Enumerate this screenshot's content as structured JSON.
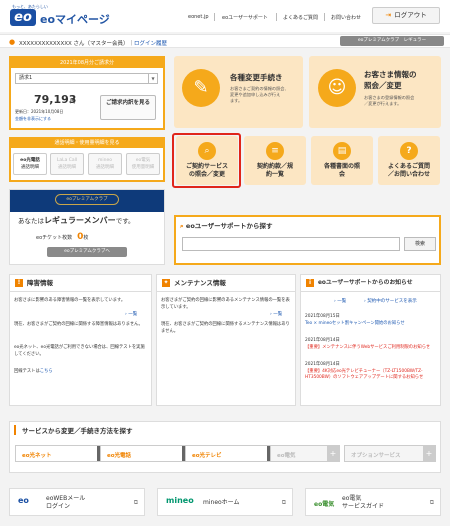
{
  "header": {
    "tagline": "もっと、あたらしい",
    "logo": "eo",
    "title": "eoマイページ",
    "nav": [
      "eonet.jp",
      "eoユーザーサポート",
      "よくあるご質問",
      "お問い合わせ"
    ],
    "logout": "ログアウト"
  },
  "user": {
    "name": "XXXXXXXXXXXXXX さん（マスター会員）",
    "login_history": "ログイン履歴",
    "premium_badge": "eoプレミアムクラブ　レギュラー"
  },
  "bill": {
    "title": "2021年08月分ご請求分",
    "select": "請求1",
    "amount": "79,193",
    "unit": "円",
    "updated": "更新日：2021年10月08日",
    "link": "金額を非表示にする",
    "detail_button": "ご請求内訳を見る"
  },
  "calls": {
    "title": "通話明細・使用量明細を見る",
    "items": [
      {
        "line1": "eo光電話",
        "line2": "通話明細"
      },
      {
        "line1": "LaLa Call",
        "line2": "通話明細"
      },
      {
        "line1": "mineo",
        "line2": "通話明細"
      },
      {
        "line1": "eo電気",
        "line2": "使用量明細"
      }
    ]
  },
  "premium": {
    "logo": "eoプレミアムクラブ",
    "member_prefix": "あなたは",
    "member_rank": "レギュラーメンバー",
    "member_suffix": "です。",
    "ticket_label": "eoチケット枚数",
    "ticket_count": "0",
    "ticket_unit": "枚",
    "button": "eoプレミアムクラブへ"
  },
  "tiles": {
    "procedures": {
      "title": "各種変更手続き",
      "desc": [
        "お客さまご契約の情報の照会、",
        "変更や追加申し込みが行え",
        "ます。"
      ]
    },
    "customer": {
      "title1": "お客さま情報の",
      "title2": "照会／変更",
      "desc": [
        "お客さまの登録情報の照会",
        "／変更が行えます。"
      ]
    },
    "small": [
      {
        "line1": "ご契約サービス",
        "line2": "の照会／変更"
      },
      {
        "line1": "契約約款／規",
        "line2": "約一覧"
      },
      {
        "line1": "各種書面の照",
        "line2": "会"
      },
      {
        "line1": "よくあるご質問",
        "line2": "／お問い合わせ"
      }
    ]
  },
  "search": {
    "title": "eoユーザーサポートから探す",
    "button": "検索",
    "placeholder": ""
  },
  "trouble": {
    "title": "障害情報",
    "p1": [
      "お客さまに影響のある障害情報の一覧を表示しています。"
    ],
    "list_link": "一覧",
    "p2": [
      "現在、お客さまがご契約の回線に関係する障害情報はありません。"
    ],
    "p3": [
      "eo光ネット、eo光電話がご利用できない場合は、回線テストを実施してください。"
    ],
    "test_label": "回線テストは",
    "test_link": "こちら"
  },
  "maintenance": {
    "title": "メンテナンス情報",
    "p1": [
      "お客さまがご契約の回線に影響のあるメンテナンス情報の一覧を表示しています。"
    ],
    "list_link": "一覧",
    "p2": [
      "現在、お客さまがご契約の回線に関係するメンテナンス情報はありません。"
    ]
  },
  "news": {
    "title": "eoユーザーサポートからのお知らせ",
    "list_link": "一覧",
    "svc_link": "契約中のサービスを表示",
    "items": [
      {
        "date": "2021年08月15日",
        "text": "Teo × mineoセット割キャンペーン開始のお知らせ",
        "type": "normal"
      },
      {
        "date": "2021年08月14日",
        "text": "【重要】メンテナンスに伴うWebサービスご利用制限のお知らせ",
        "type": "important"
      },
      {
        "date": "2021年08月14日",
        "text": "【重要】4K対応eo光テレビチューナー（TZ-LT1500BW/TZ-HT3500BW）のソフトウェアアップデートに関するお知らせ",
        "type": "important"
      }
    ]
  },
  "service_change": {
    "title": "サービスから変更／手続き方法を探す",
    "items": [
      {
        "name": "eo光ネット",
        "disabled": false
      },
      {
        "name": "eo光電話",
        "disabled": false
      },
      {
        "name": "eo光テレビ",
        "disabled": false
      },
      {
        "name": "eo電気",
        "disabled": true
      },
      {
        "name": "オプションサービス",
        "disabled": true
      }
    ]
  },
  "bottom_links": [
    {
      "logo": "eo",
      "line1": "eoWEBメール",
      "line2": "ログイン"
    },
    {
      "logo": "mineo",
      "line1": "mineoホーム",
      "line2": ""
    },
    {
      "logo": "eo電気",
      "line1": "eo電気",
      "line2": "サービスガイド"
    }
  ],
  "colors": {
    "accent": "#f5a91b",
    "brand": "#1a4fa3",
    "highlight": "#e0251b",
    "tile_bg": "#fce6c3"
  }
}
